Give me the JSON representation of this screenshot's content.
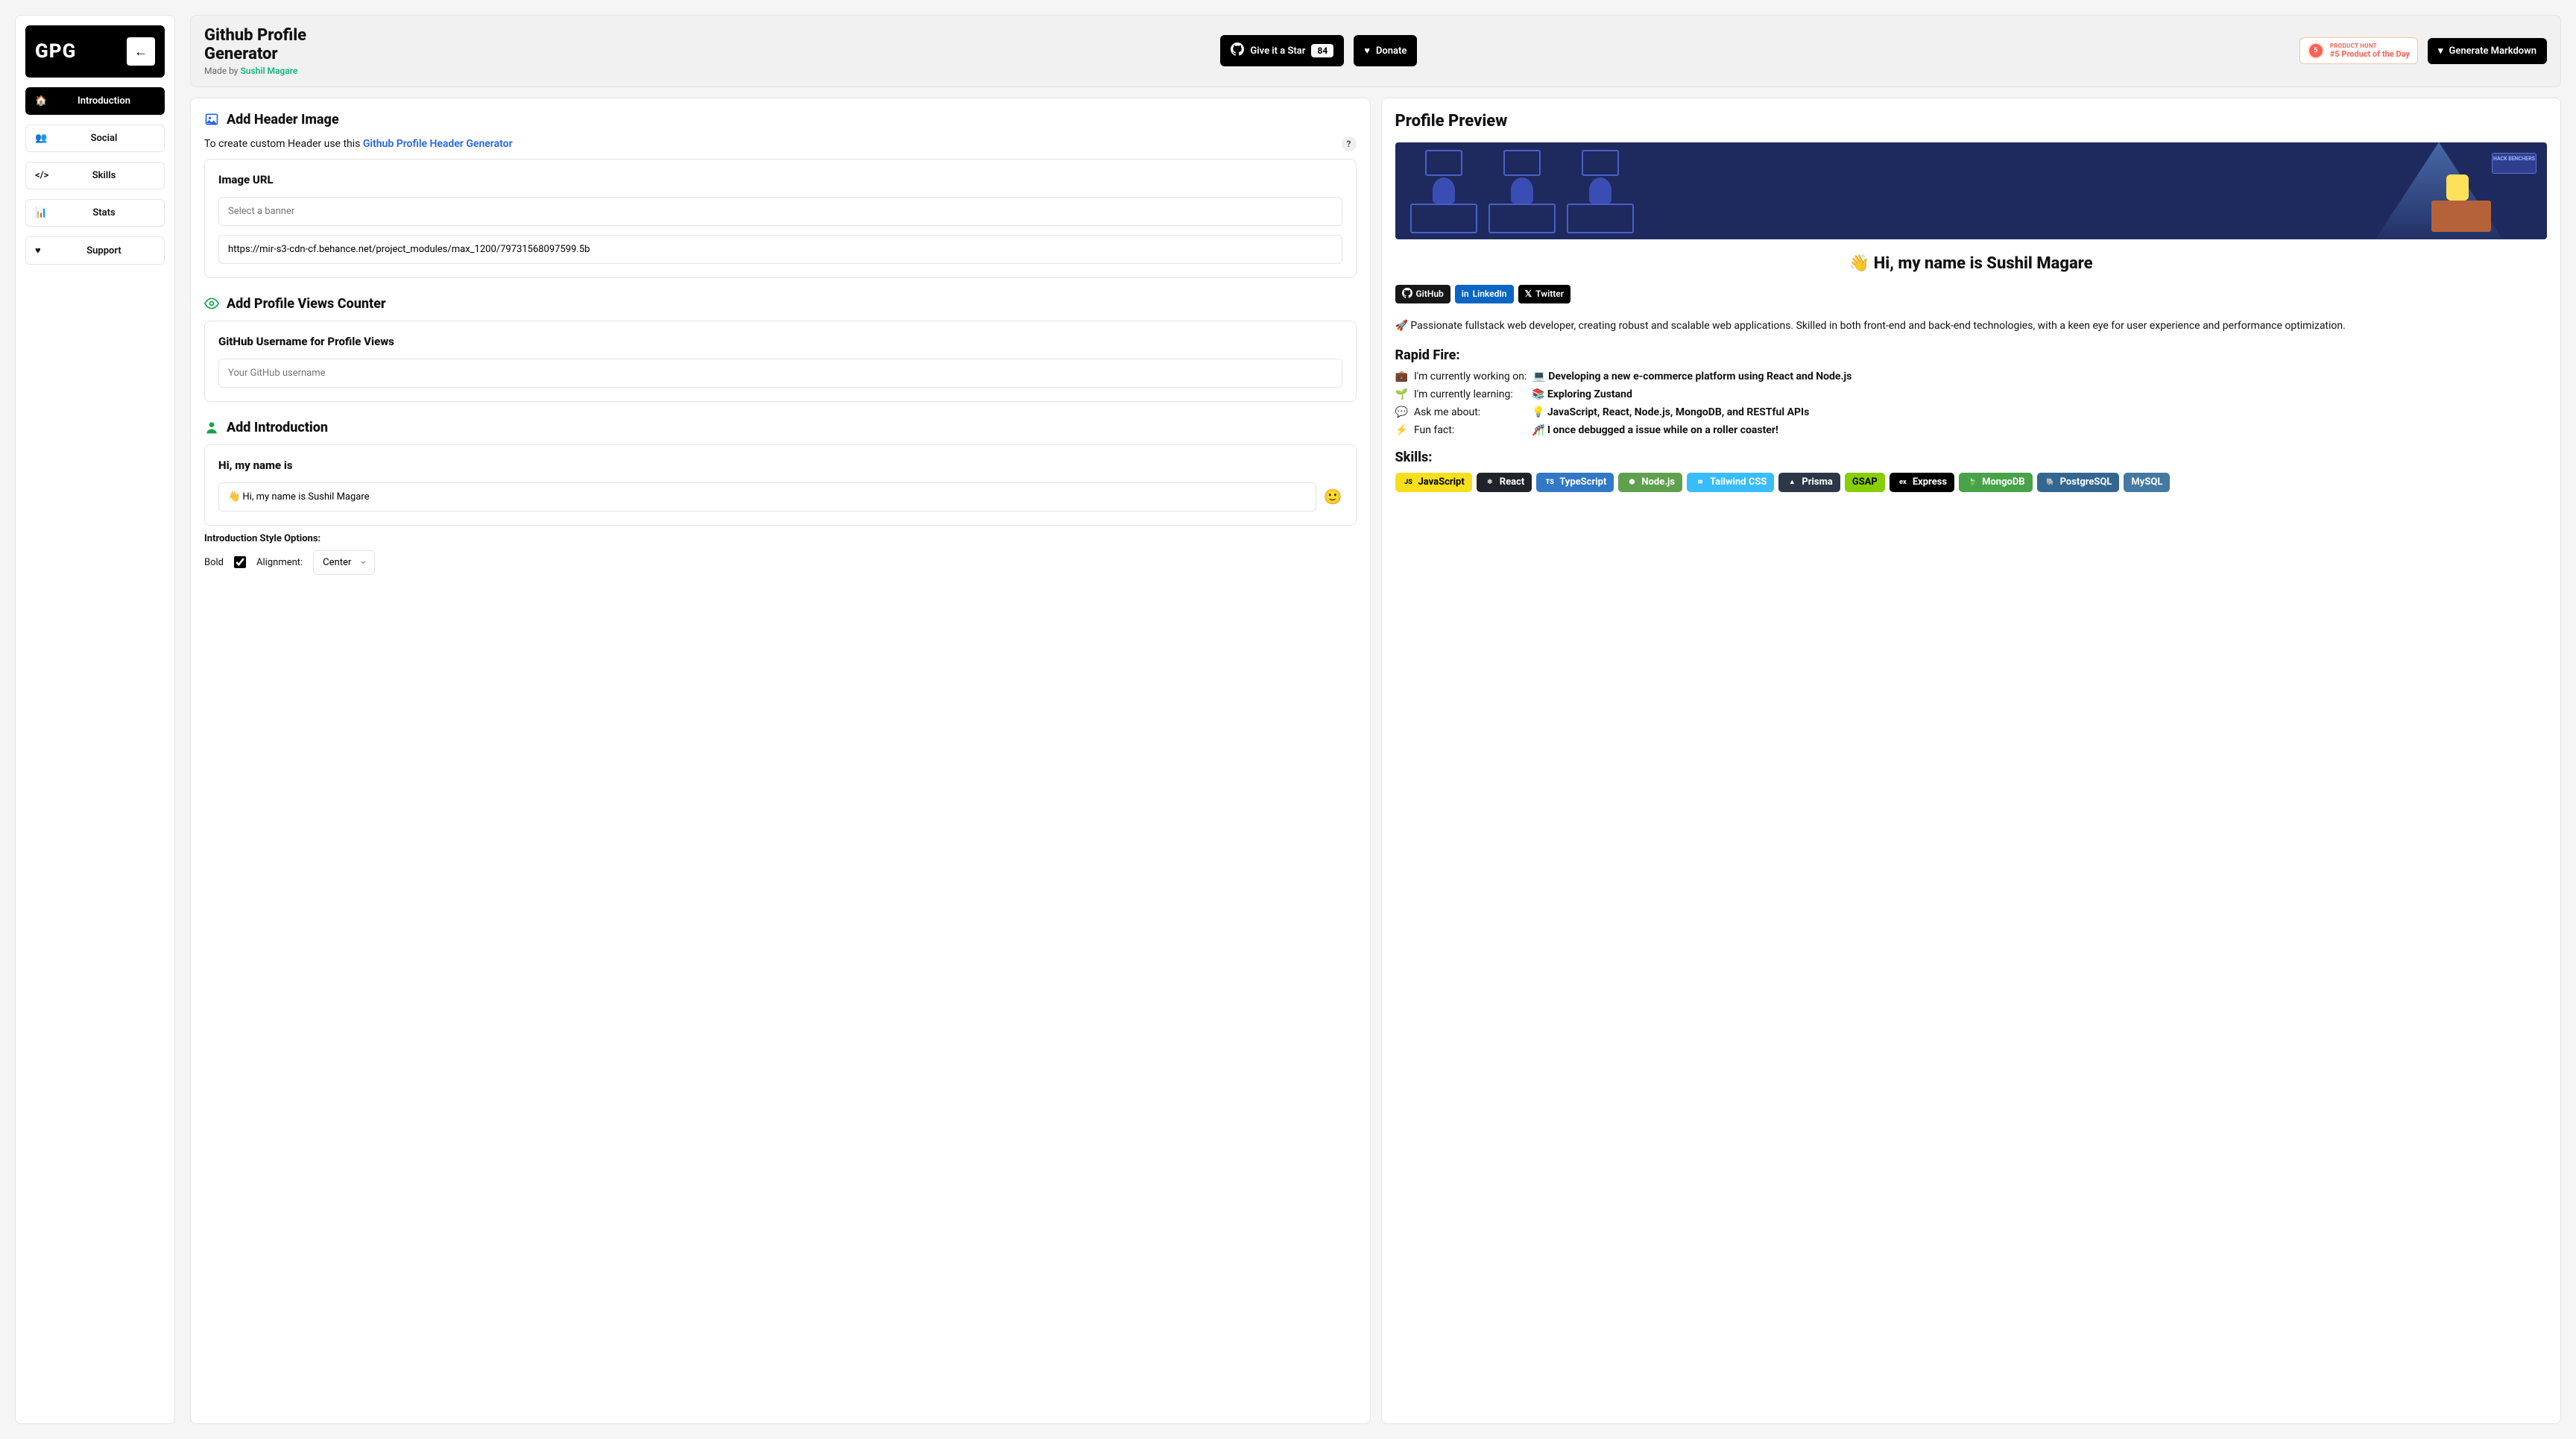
{
  "sidebar": {
    "logo": "GPG",
    "back": "←",
    "items": [
      {
        "icon": "home",
        "label": "Introduction",
        "active": true
      },
      {
        "icon": "users",
        "label": "Social"
      },
      {
        "icon": "code",
        "label": "Skills"
      },
      {
        "icon": "chart",
        "label": "Stats"
      },
      {
        "icon": "heart",
        "label": "Support"
      }
    ]
  },
  "topbar": {
    "title": "Github Profile Generator",
    "made_by_prefix": "Made by ",
    "made_by_name": "Sushil Magare",
    "star_label": "Give it a Star",
    "star_count": "84",
    "donate_label": "Donate",
    "ph_small": "PRODUCT HUNT",
    "ph_big": "#5 Product of the Day",
    "ph_rank": "5",
    "generate_label": "Generate Markdown"
  },
  "form": {
    "header_image": {
      "title": "Add Header Image",
      "help_prefix": "To create custom Header use this ",
      "help_link": "Github Profile Header Generator",
      "card_title": "Image URL",
      "select_placeholder": "Select a banner",
      "url_value": "https://mir-s3-cdn-cf.behance.net/project_modules/max_1200/79731568097599.5b"
    },
    "views_counter": {
      "title": "Add Profile Views Counter",
      "card_title": "GitHub Username for Profile Views",
      "placeholder": "Your GitHub username"
    },
    "introduction": {
      "title": "Add Introduction",
      "card_title": "Hi, my name is",
      "value": "👋 Hi, my name is Sushil Magare",
      "style_title": "Introduction Style Options:",
      "bold_label": "Bold",
      "align_label": "Alignment:",
      "align_value": "Center"
    }
  },
  "preview": {
    "title": "Profile Preview",
    "sign": "HACK BENCHERS",
    "greeting": "👋 Hi, my name is Sushil Magare",
    "badges": {
      "github": "GitHub",
      "linkedin": "LinkedIn",
      "twitter": "Twitter"
    },
    "bio": "🚀 Passionate fullstack web developer, creating robust and scalable web applications. Skilled in both front-end and back-end technologies, with a keen eye for user experience and performance optimization.",
    "rapid_fire_title": "Rapid Fire:",
    "rapid_fire": [
      {
        "emoji": "💼",
        "label": "I'm currently working on:",
        "answer": "💻 Developing a new e-commerce platform using React and Node.js"
      },
      {
        "emoji": "🌱",
        "label": "I'm currently learning:",
        "answer": "📚 Exploring Zustand"
      },
      {
        "emoji": "💬",
        "label": "Ask me about:",
        "answer": "💡 JavaScript, React, Node.js, MongoDB, and RESTful APIs"
      },
      {
        "emoji": "⚡",
        "label": "Fun fact:",
        "answer": "🎢 I once debugged a issue while on a roller coaster!"
      }
    ],
    "skills_title": "Skills:",
    "skills": [
      {
        "name": "JavaScript",
        "class": "js",
        "icon": "JS"
      },
      {
        "name": "React",
        "class": "react",
        "icon": "⚛"
      },
      {
        "name": "TypeScript",
        "class": "ts",
        "icon": "TS"
      },
      {
        "name": "Node.js",
        "class": "node",
        "icon": "⬢"
      },
      {
        "name": "Tailwind CSS",
        "class": "tw",
        "icon": "≋"
      },
      {
        "name": "Prisma",
        "class": "prisma",
        "icon": "▲"
      },
      {
        "name": "GSAP",
        "class": "gsap",
        "icon": ""
      },
      {
        "name": "Express",
        "class": "express",
        "icon": "ex"
      },
      {
        "name": "MongoDB",
        "class": "mongo",
        "icon": "🍃"
      },
      {
        "name": "PostgreSQL",
        "class": "pg",
        "icon": "🐘"
      },
      {
        "name": "MySQL",
        "class": "mysql",
        "icon": ""
      }
    ]
  }
}
